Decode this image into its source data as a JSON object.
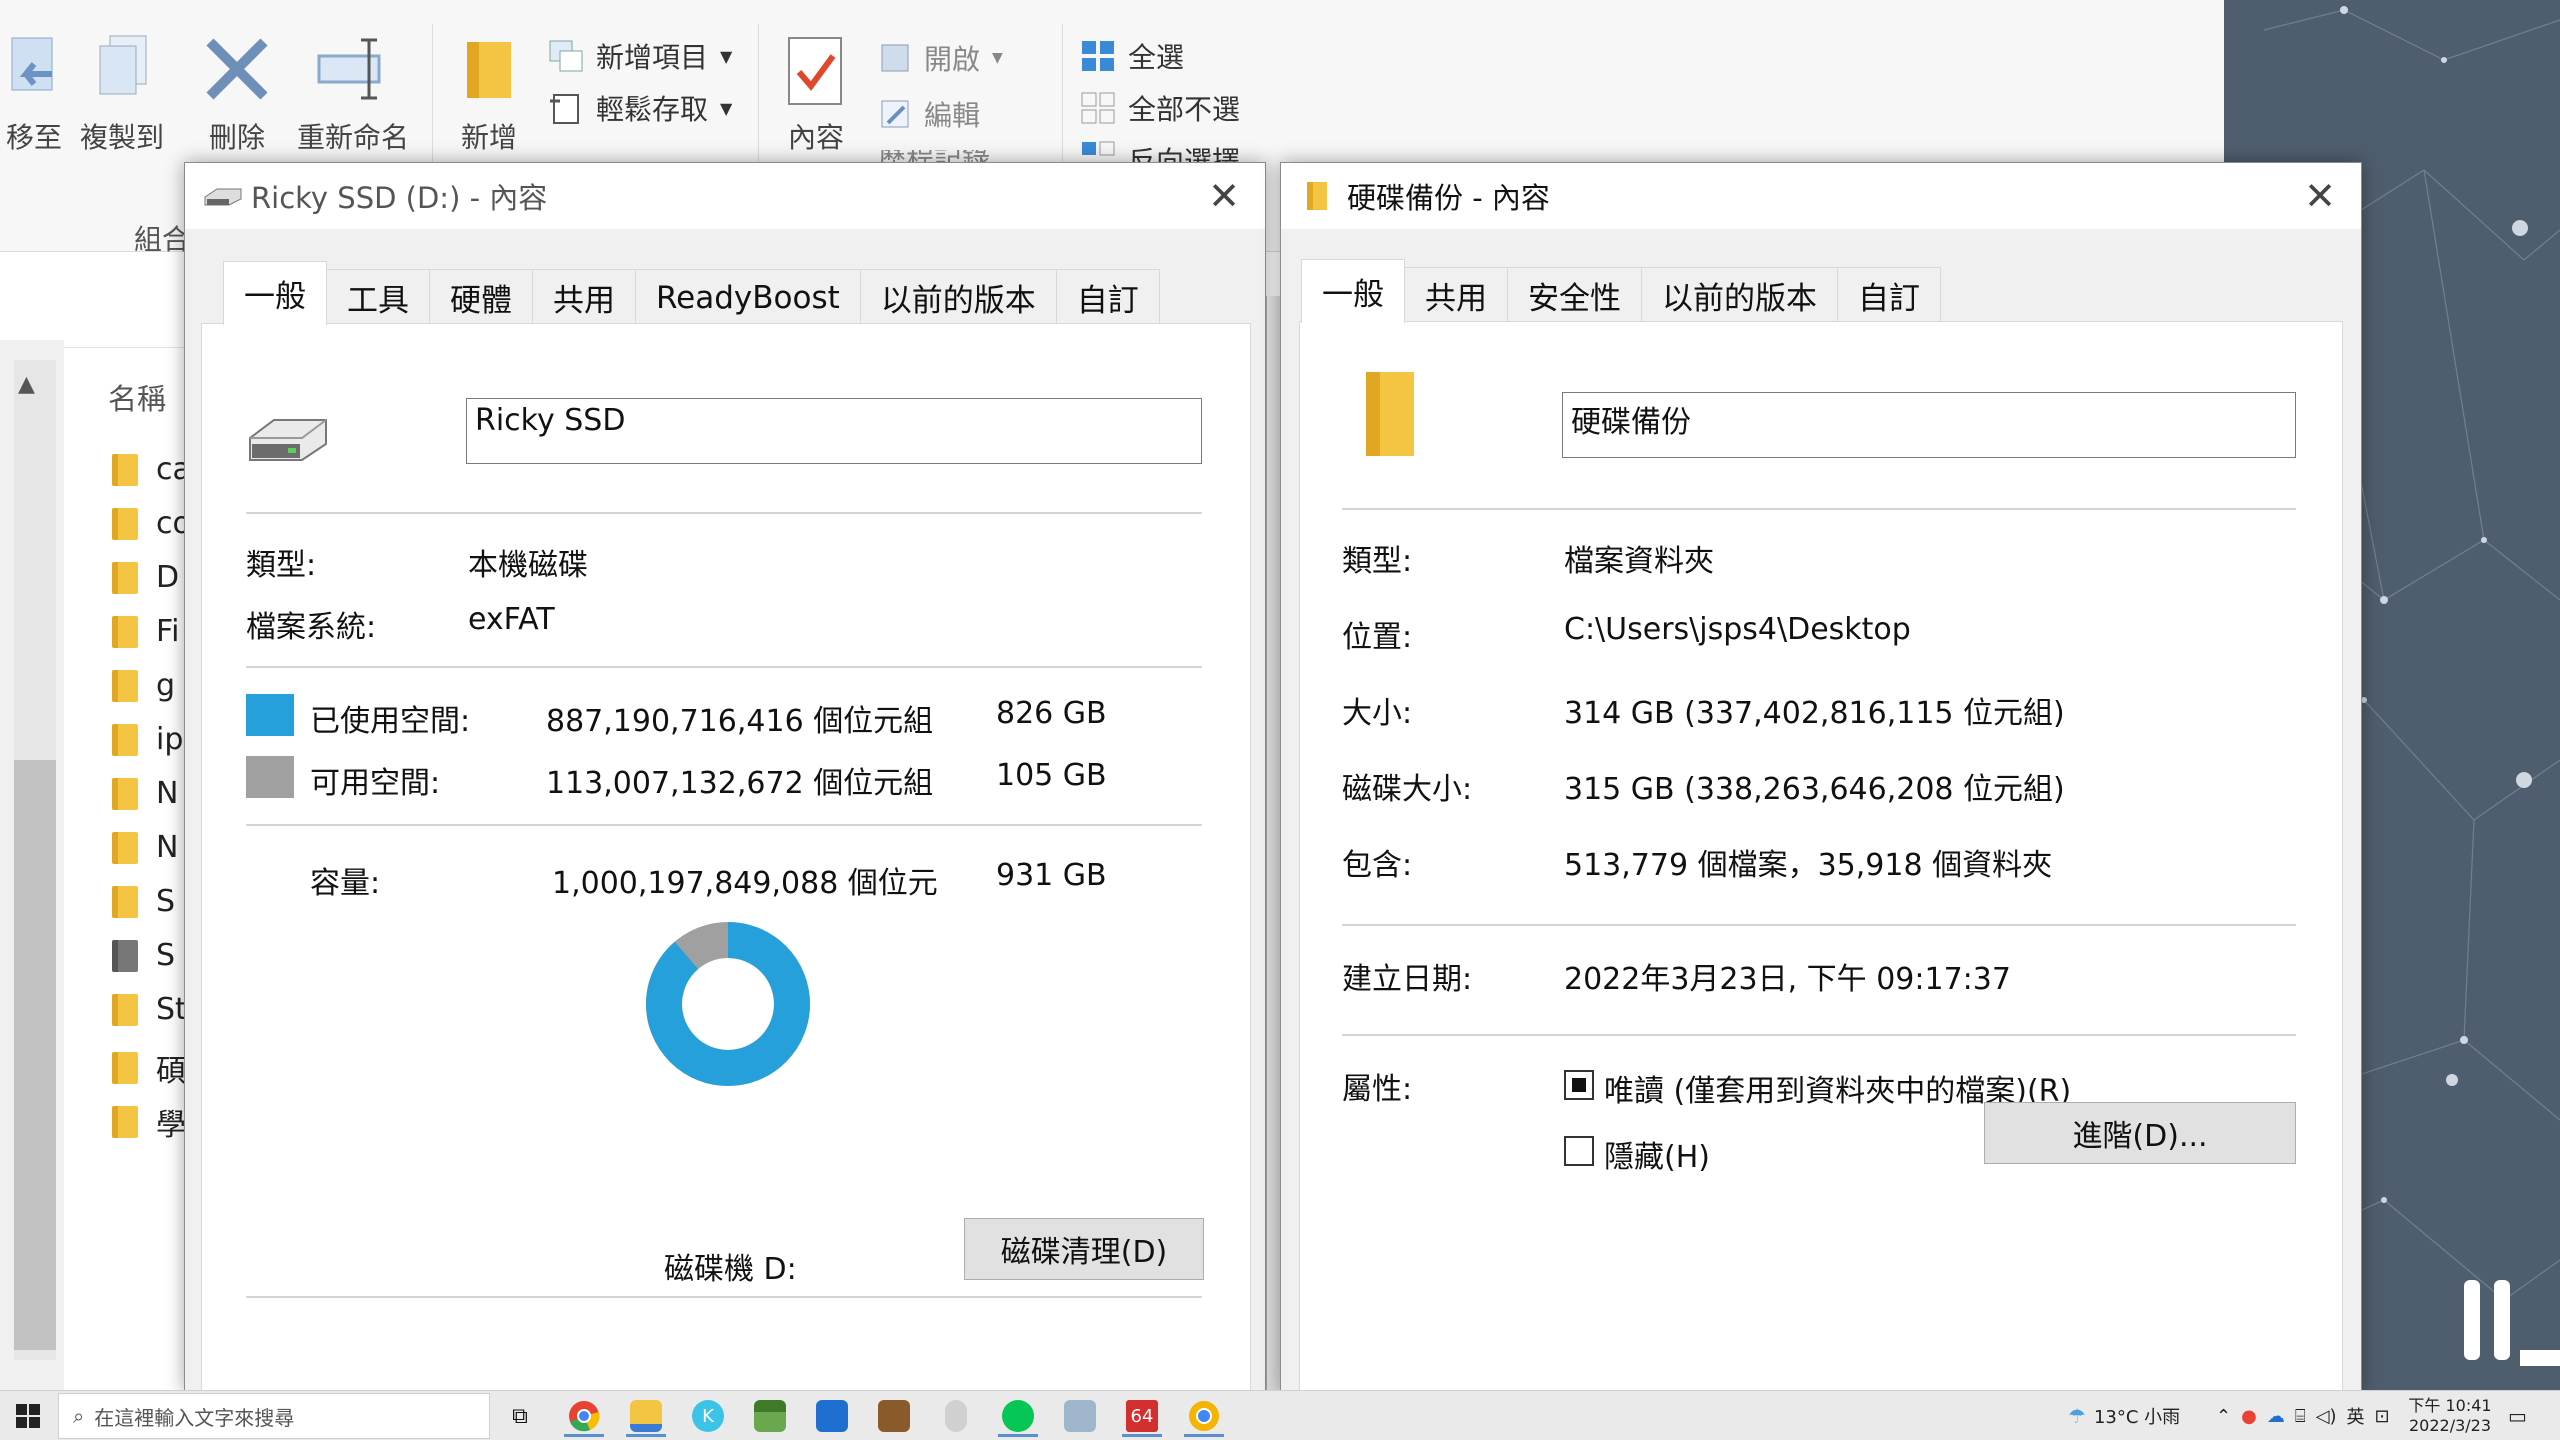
{
  "explorer": {
    "ribbon": {
      "move_to": "移至",
      "copy_to": "複製到",
      "delete": "刪除",
      "rename": "重新命名",
      "new_folder": "新增",
      "new_item": "新增項目",
      "easy_access": "輕鬆存取",
      "properties": "內容",
      "open": "開啟",
      "edit": "編輯",
      "history": "歷程記錄",
      "select_all": "全選",
      "select_none": "全部不選",
      "invert_selection": "反向選擇",
      "organize_group": "組合"
    },
    "column_name": "名稱",
    "rows": [
      "ca",
      "co",
      "D",
      "Fi",
      "g",
      "ip",
      "N",
      "N",
      "S",
      "S",
      "St",
      "碩",
      "學"
    ]
  },
  "drive_dialog": {
    "title": "Ricky SSD (D:) - 內容",
    "tabs": [
      "一般",
      "工具",
      "硬體",
      "共用",
      "ReadyBoost",
      "以前的版本",
      "自訂"
    ],
    "name_value": "Ricky SSD",
    "type_label": "類型:",
    "type_value": "本機磁碟",
    "fs_label": "檔案系統:",
    "fs_value": "exFAT",
    "used_label": "已使用空間:",
    "used_bytes": "887,190,716,416 個位元組",
    "used_gb": "826 GB",
    "free_label": "可用空間:",
    "free_bytes": "113,007,132,672 個位元組",
    "free_gb": "105 GB",
    "capacity_label": "容量:",
    "capacity_bytes": "1,000,197,849,088 個位元",
    "capacity_gb": "931 GB",
    "drive_label": "磁碟機 D:",
    "cleanup_button": "磁碟清理(D)",
    "used_color": "#26a0da",
    "free_color": "#a0a0a0",
    "used_fraction": 0.887
  },
  "folder_dialog": {
    "title": "硬碟備份 - 內容",
    "tabs": [
      "一般",
      "共用",
      "安全性",
      "以前的版本",
      "自訂"
    ],
    "name_value": "硬碟備份",
    "type_label": "類型:",
    "type_value": "檔案資料夾",
    "location_label": "位置:",
    "location_value": "C:\\Users\\jsps4\\Desktop",
    "size_label": "大小:",
    "size_value": "314 GB (337,402,816,115 位元組)",
    "disk_size_label": "磁碟大小:",
    "disk_size_value": "315 GB (338,263,646,208 位元組)",
    "contains_label": "包含:",
    "contains_value": "513,779 個檔案，35,918 個資料夾",
    "created_label": "建立日期:",
    "created_value": "2022年3月23日, 下午 09:17:37",
    "attributes_label": "屬性:",
    "readonly_label": "唯讀 (僅套用到資料夾中的檔案)(R)",
    "hidden_label": "隱藏(H)",
    "advanced_button": "進階(D)..."
  },
  "taskbar": {
    "search_placeholder": "在這裡輸入文字來搜尋",
    "weather": "13°C 小雨",
    "ime": "英",
    "time": "下午 10:41",
    "date": "2022/3/23",
    "app_badge": "64"
  }
}
